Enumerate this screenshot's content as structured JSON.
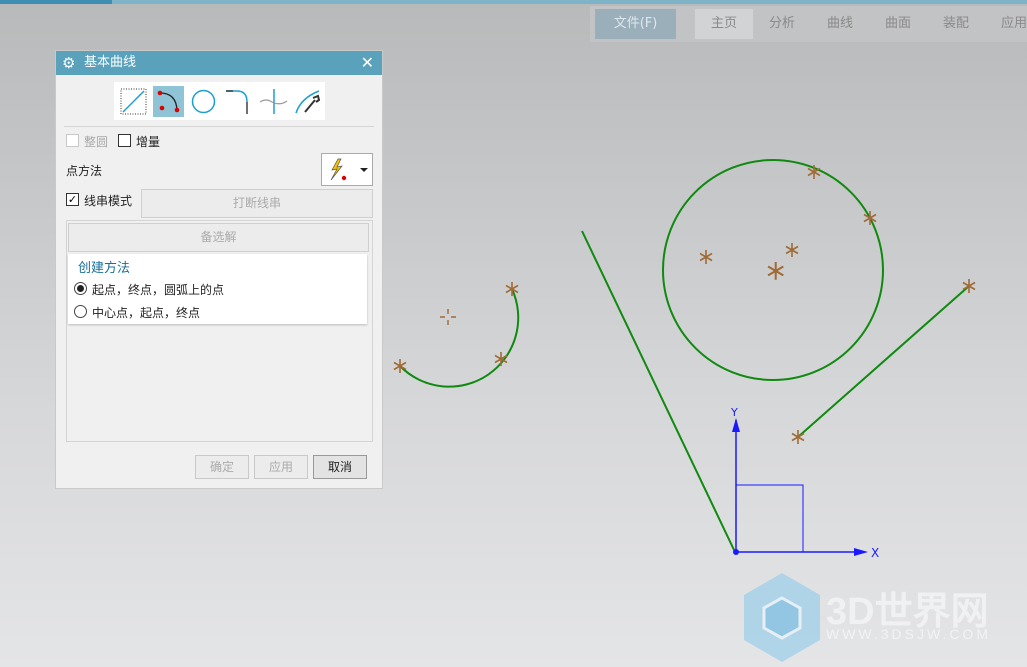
{
  "ribbon": {
    "file": "文件(F)",
    "tabs": [
      "主页",
      "分析",
      "曲线",
      "曲面",
      "装配",
      "应用"
    ],
    "active": "主页"
  },
  "dialog": {
    "title": "基本曲线",
    "tools": [
      "line-icon",
      "arc-icon",
      "circle-icon",
      "fillet-icon",
      "trim-icon",
      "edit-curve-icon"
    ],
    "selected_tool": "arc-icon",
    "full_circle": {
      "label": "整圆",
      "checked": false,
      "enabled": false
    },
    "increment": {
      "label": "增量",
      "checked": false
    },
    "point_method_label": "点方法",
    "point_method_icon": "inferred-point-icon",
    "string_mode": {
      "label": "线串模式",
      "checked": true
    },
    "break_string": "打断线串",
    "alternate": "备选解",
    "create_method": {
      "title": "创建方法",
      "options": [
        "起点，终点，圆弧上的点",
        "中心点，起点，终点"
      ],
      "selected": 0
    },
    "buttons": {
      "ok": "确定",
      "apply": "应用",
      "cancel": "取消"
    }
  },
  "axes": {
    "x": "X",
    "y": "Y"
  },
  "colors": {
    "curve": "#0f8a0f",
    "marker": "#a06a35",
    "axis": "#1a1aff",
    "title_bar": "#5aa1bc"
  },
  "watermark": {
    "title": "3D世界网",
    "url": "WWW.3DSJW.COM"
  }
}
